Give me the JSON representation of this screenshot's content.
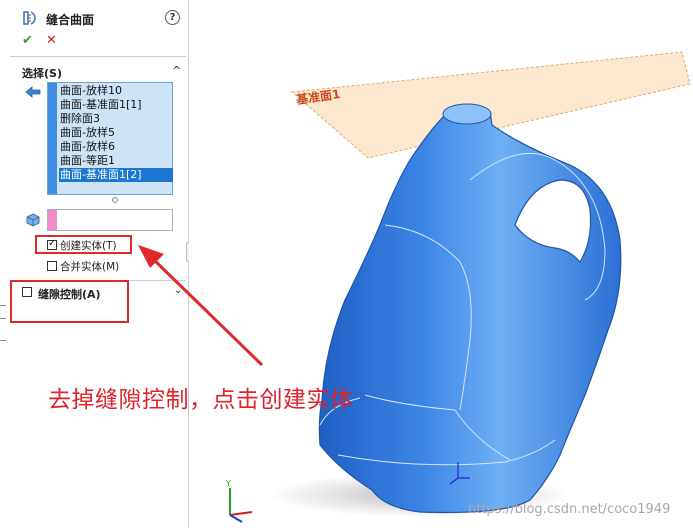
{
  "panel": {
    "title": "缝合曲面",
    "help": "?",
    "ok": "✔",
    "cancel": "✕",
    "selection_section": {
      "title": "选择(S)",
      "collapse": "^",
      "items": [
        {
          "label": "曲面-放样10",
          "selected": false
        },
        {
          "label": "曲面-基准面1[1]",
          "selected": false
        },
        {
          "label": "删除面3",
          "selected": false
        },
        {
          "label": "曲面-放样5",
          "selected": false
        },
        {
          "label": "曲面-放样6",
          "selected": false
        },
        {
          "label": "曲面-等距1",
          "selected": false
        },
        {
          "label": "曲面-基准面1[2]",
          "selected": true
        }
      ]
    },
    "body_field_value": "",
    "create_solid": {
      "label": "创建实体(T)",
      "checked": true
    },
    "merge_solid": {
      "label": "合并实体(M)",
      "checked": false
    },
    "gap_control": {
      "label": "缝隙控制(A)",
      "checked": false,
      "chevron": "⌄"
    }
  },
  "annotation": {
    "text": "去掉缝隙控制，点击创建实体",
    "color": "#e0222a"
  },
  "viewport": {
    "plane_label": "基准面1",
    "watermark": "https://blog.csdn.net/coco1949",
    "bottle_color": "#3d86e6",
    "plane_color": "#fbe3c7"
  }
}
